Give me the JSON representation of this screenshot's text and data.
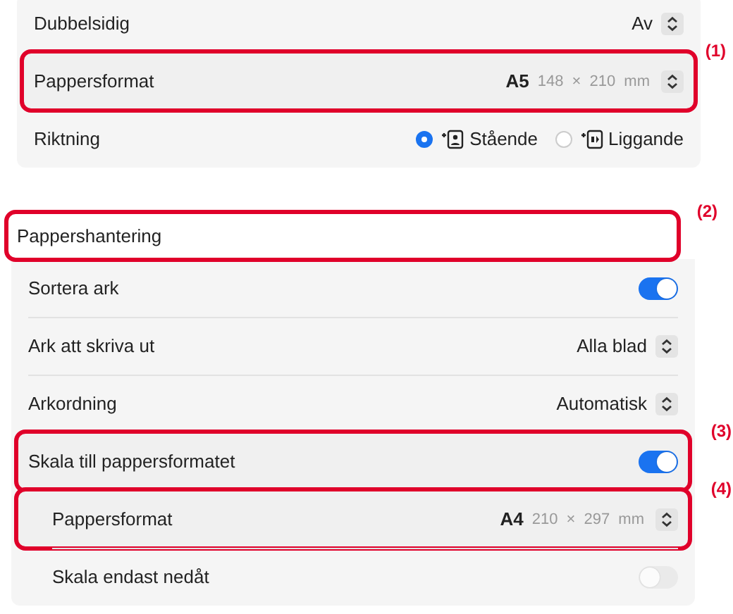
{
  "panels": [
    {
      "rows": [
        {
          "kind": "popup",
          "label": "Dubbelsidig",
          "value": "Av"
        },
        {
          "kind": "paper",
          "label": "Pappersformat",
          "size": "A5",
          "dimensions": "148 × 210 mm",
          "callout": "(1)"
        },
        {
          "kind": "radio",
          "label": "Riktning",
          "options": [
            {
              "label": "Stående",
              "selected": true
            },
            {
              "label": "Liggande",
              "selected": false
            }
          ]
        }
      ]
    },
    {
      "header": {
        "title": "Pappershantering",
        "callout": "(2)"
      },
      "rows": [
        {
          "kind": "toggle",
          "label": "Sortera ark",
          "on": true,
          "disabled": false
        },
        {
          "kind": "popup",
          "label": "Ark att skriva ut",
          "value": "Alla blad"
        },
        {
          "kind": "popup",
          "label": "Arkordning",
          "value": "Automatisk"
        },
        {
          "kind": "toggle",
          "label": "Skala till pappersformatet",
          "on": true,
          "disabled": false,
          "callout": "(3)",
          "children": [
            {
              "kind": "paper",
              "label": "Pappersformat",
              "size": "A4",
              "dimensions": "210 × 297 mm",
              "callout": "(4)"
            },
            {
              "kind": "toggle",
              "label": "Skala endast nedåt",
              "on": false,
              "disabled": true
            }
          ]
        }
      ]
    }
  ]
}
